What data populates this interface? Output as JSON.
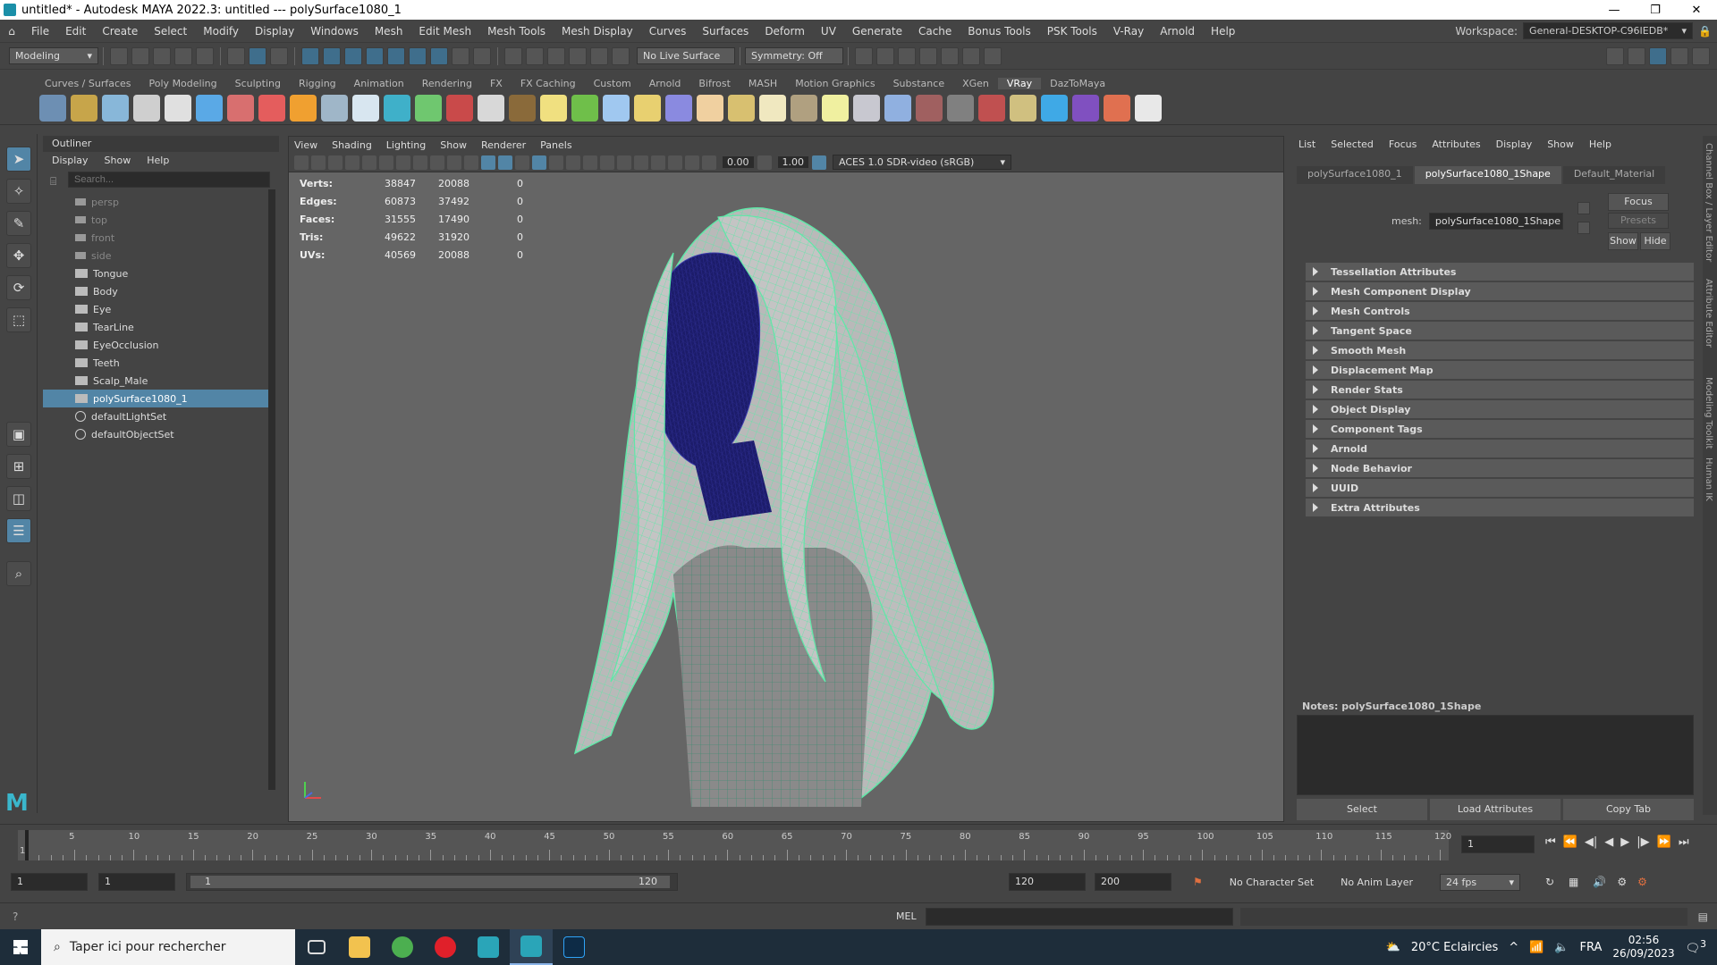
{
  "window": {
    "title": "untitled* - Autodesk MAYA 2022.3: untitled   ---   polySurface1080_1"
  },
  "menus": [
    "File",
    "Edit",
    "Create",
    "Select",
    "Modify",
    "Display",
    "Windows",
    "Mesh",
    "Edit Mesh",
    "Mesh Tools",
    "Mesh Display",
    "Curves",
    "Surfaces",
    "Deform",
    "UV",
    "Generate",
    "Cache",
    "Bonus Tools",
    "PSK Tools",
    "V-Ray",
    "Arnold",
    "Help"
  ],
  "workspace": {
    "label": "Workspace:",
    "value": "General-DESKTOP-C96IEDB*"
  },
  "statusline": {
    "mode": "Modeling",
    "live_surface": "No Live Surface",
    "symmetry": "Symmetry: Off"
  },
  "shelf_tabs": [
    "Curves / Surfaces",
    "Poly Modeling",
    "Sculpting",
    "Rigging",
    "Animation",
    "Rendering",
    "FX",
    "FX Caching",
    "Custom",
    "Arnold",
    "Bifrost",
    "MASH",
    "Motion Graphics",
    "Substance",
    "XGen",
    "VRay",
    "DazToMaya"
  ],
  "shelf_active": "VRay",
  "shelf_icon_colors": [
    "#6d8fb3",
    "#c7a54a",
    "#88b7d9",
    "#cfcfcf",
    "#e0e0e0",
    "#5aa9e6",
    "#d86f6f",
    "#e45d5d",
    "#f0a030",
    "#9fb6c8",
    "#d8e6f0",
    "#3fb0c9",
    "#6fc76f",
    "#c94a4a",
    "#d8d8d8",
    "#8a6a3a",
    "#f0e080",
    "#6fbf4a",
    "#a0c8f0",
    "#e8d070",
    "#8a8ae0",
    "#f0d0a0",
    "#d8c070",
    "#f0e8c0",
    "#b0a080",
    "#f0f0a0",
    "#c8c8d0",
    "#90b0e0",
    "#a06060",
    "#808080",
    "#c05050",
    "#d0c080",
    "#3fa9e6",
    "#8050c0",
    "#e07050",
    "#e8e8e8"
  ],
  "outliner": {
    "title": "Outliner",
    "menu": [
      "Display",
      "Show",
      "Help"
    ],
    "search_placeholder": "Search...",
    "items": [
      {
        "label": "persp",
        "type": "camera",
        "dim": true
      },
      {
        "label": "top",
        "type": "camera",
        "dim": true
      },
      {
        "label": "front",
        "type": "camera",
        "dim": true
      },
      {
        "label": "side",
        "type": "camera",
        "dim": true
      },
      {
        "label": "Tongue",
        "type": "mesh"
      },
      {
        "label": "Body",
        "type": "mesh"
      },
      {
        "label": "Eye",
        "type": "mesh"
      },
      {
        "label": "TearLine",
        "type": "mesh"
      },
      {
        "label": "EyeOcclusion",
        "type": "mesh"
      },
      {
        "label": "Teeth",
        "type": "mesh"
      },
      {
        "label": "Scalp_Male",
        "type": "mesh"
      },
      {
        "label": "polySurface1080_1",
        "type": "mesh",
        "selected": true
      },
      {
        "label": "defaultLightSet",
        "type": "set"
      },
      {
        "label": "defaultObjectSet",
        "type": "set"
      }
    ]
  },
  "viewport": {
    "menu": [
      "View",
      "Shading",
      "Lighting",
      "Show",
      "Renderer",
      "Panels"
    ],
    "value_a": "0.00",
    "value_b": "1.00",
    "color_space": "ACES 1.0 SDR-video (sRGB)",
    "hud": [
      {
        "label": "Verts:",
        "a": "38847",
        "b": "20088",
        "c": "0"
      },
      {
        "label": "Edges:",
        "a": "60873",
        "b": "37492",
        "c": "0"
      },
      {
        "label": "Faces:",
        "a": "31555",
        "b": "17490",
        "c": "0"
      },
      {
        "label": "Tris:",
        "a": "49622",
        "b": "31920",
        "c": "0"
      },
      {
        "label": "UVs:",
        "a": "40569",
        "b": "20088",
        "c": "0"
      }
    ],
    "wire_color": "#5fe8a8",
    "face_wire_color": "#2a2a8a"
  },
  "attribute_editor": {
    "menu": [
      "List",
      "Selected",
      "Focus",
      "Attributes",
      "Display",
      "Show",
      "Help"
    ],
    "tabs": [
      "polySurface1080_1",
      "polySurface1080_1Shape",
      "Default_Material"
    ],
    "active_tab": "polySurface1080_1Shape",
    "mesh_label": "mesh:",
    "mesh_value": "polySurface1080_1Shape",
    "focus": "Focus",
    "presets": "Presets",
    "show": "Show",
    "hide": "Hide",
    "sections": [
      "Tessellation Attributes",
      "Mesh Component Display",
      "Mesh Controls",
      "Tangent Space",
      "Smooth Mesh",
      "Displacement Map",
      "Render Stats",
      "Object Display",
      "Component Tags",
      "Arnold",
      "Node Behavior",
      "UUID",
      "Extra Attributes"
    ],
    "notes_label": "Notes:  polySurface1080_1Shape",
    "buttons": [
      "Select",
      "Load Attributes",
      "Copy Tab"
    ]
  },
  "side_tabs": [
    "Channel Box / Layer Editor",
    "Attribute Editor",
    "Modeling Toolkit",
    "Human IK"
  ],
  "timeline": {
    "labels": [
      "5",
      "10",
      "15",
      "20",
      "25",
      "30",
      "35",
      "40",
      "45",
      "50",
      "55",
      "60",
      "65",
      "70",
      "75",
      "80",
      "85",
      "90",
      "95",
      "100",
      "105",
      "110",
      "115",
      "120"
    ],
    "start": "1",
    "current_frame": "1"
  },
  "range": {
    "start": "1",
    "playback_start": "1",
    "slider_start": "1",
    "slider_end": "120",
    "playback_end": "120",
    "end": "200",
    "character_set": "No Character Set",
    "anim_layer": "No Anim Layer",
    "fps": "24 fps"
  },
  "cmdline": {
    "lang": "MEL"
  },
  "taskbar": {
    "search_placeholder": "Taper ici pour rechercher",
    "weather": "20°C  Eclaircies",
    "lang": "FRA",
    "time": "02:56",
    "date": "26/09/2023",
    "notifications": "3"
  }
}
